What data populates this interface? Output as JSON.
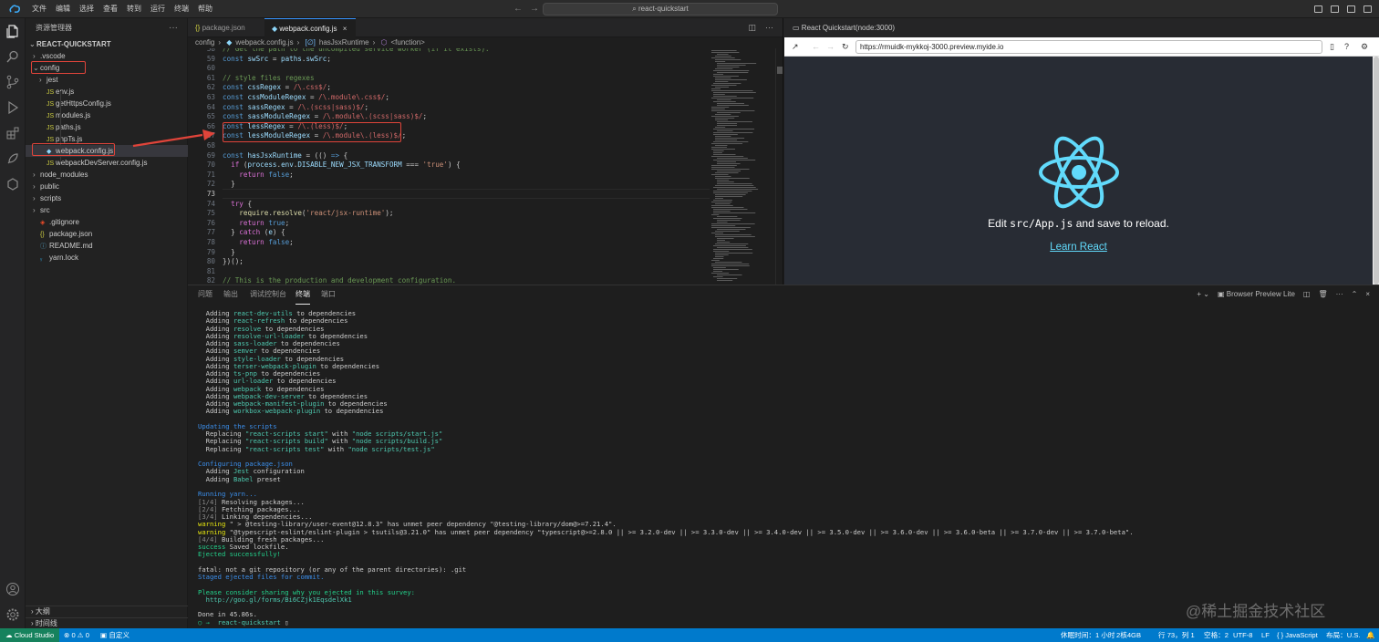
{
  "titlebar": {
    "menu": [
      "文件",
      "编辑",
      "选择",
      "查看",
      "转到",
      "运行",
      "终端",
      "帮助"
    ],
    "command_center": "react-quickstart"
  },
  "sidebar": {
    "title": "资源管理器",
    "root": "REACT-QUICKSTART",
    "items": [
      {
        "label": ".vscode",
        "kind": "folder",
        "open": false,
        "depth": 1
      },
      {
        "label": "config",
        "kind": "folder",
        "open": true,
        "depth": 1
      },
      {
        "label": "jest",
        "kind": "folder",
        "open": false,
        "depth": 2
      },
      {
        "label": "env.js",
        "kind": "js",
        "depth": 2
      },
      {
        "label": "getHttpsConfig.js",
        "kind": "js",
        "depth": 2
      },
      {
        "label": "modules.js",
        "kind": "js",
        "depth": 2
      },
      {
        "label": "paths.js",
        "kind": "js",
        "depth": 2
      },
      {
        "label": "pnpTs.js",
        "kind": "js",
        "depth": 2
      },
      {
        "label": "webpack.config.js",
        "kind": "webpack",
        "depth": 2,
        "selected": true
      },
      {
        "label": "webpackDevServer.config.js",
        "kind": "js",
        "depth": 2
      },
      {
        "label": "node_modules",
        "kind": "folder",
        "open": false,
        "depth": 1
      },
      {
        "label": "public",
        "kind": "folder",
        "open": false,
        "depth": 1
      },
      {
        "label": "scripts",
        "kind": "folder",
        "open": false,
        "depth": 1
      },
      {
        "label": "src",
        "kind": "folder",
        "open": false,
        "depth": 1
      },
      {
        "label": ".gitignore",
        "kind": "git",
        "depth": 1
      },
      {
        "label": "package.json",
        "kind": "json",
        "depth": 1
      },
      {
        "label": "README.md",
        "kind": "info",
        "depth": 1
      },
      {
        "label": "yarn.lock",
        "kind": "yarn",
        "depth": 1
      }
    ],
    "outline": "大纲",
    "timeline": "时间线"
  },
  "editor": {
    "tabs": [
      {
        "label": "package.json",
        "icon": "{}",
        "active": false
      },
      {
        "label": "webpack.config.js",
        "icon": "webpack-icon",
        "active": true
      }
    ],
    "breadcrumb": [
      "config",
      "webpack.config.js",
      "hasJsxRuntime",
      "<function>"
    ],
    "code_lines": [
      {
        "n": "58",
        "html": "<span class=\"cm\">// Get the path to the uncompiled service worker (if it exists).</span>"
      },
      {
        "n": "59",
        "html": "<span class=\"kw\">const</span> <span class=\"vr\">swSrc</span> = <span class=\"vr\">paths</span>.<span class=\"vr\">swSrc</span>;"
      },
      {
        "n": "60",
        "html": ""
      },
      {
        "n": "61",
        "html": "<span class=\"cm\">// style files regexes</span>"
      },
      {
        "n": "62",
        "html": "<span class=\"kw\">const</span> <span class=\"vr\">cssRegex</span> = <span class=\"rx\">/\\.css$/</span>;"
      },
      {
        "n": "63",
        "html": "<span class=\"kw\">const</span> <span class=\"vr\">cssModuleRegex</span> = <span class=\"rx\">/\\.module\\.css$/</span>;"
      },
      {
        "n": "64",
        "html": "<span class=\"kw\">const</span> <span class=\"vr\">sassRegex</span> = <span class=\"rx\">/\\.(scss|sass)$/</span>;"
      },
      {
        "n": "65",
        "html": "<span class=\"kw\">const</span> <span class=\"vr\">sassModuleRegex</span> = <span class=\"rx\">/\\.module\\.(scss|sass)$/</span>;"
      },
      {
        "n": "66",
        "html": "<span class=\"kw\">const</span> <span class=\"vr\">lessRegex</span> = <span class=\"rx\">/\\.(less)$/</span>;"
      },
      {
        "n": "67",
        "html": "<span class=\"kw\">const</span> <span class=\"vr\">lessModuleRegex</span> = <span class=\"rx\">/\\.module\\.(less)$/</span>;"
      },
      {
        "n": "68",
        "html": ""
      },
      {
        "n": "69",
        "html": "<span class=\"kw\">const</span> <span class=\"vr\">hasJsxRuntime</span> = (() <span class=\"kw\">=&gt;</span> {"
      },
      {
        "n": "70",
        "html": "  <span class=\"br\">if</span> (<span class=\"vr\">process</span>.<span class=\"vr\">env</span>.<span class=\"vr\">DISABLE_NEW_JSX_TRANSFORM</span> === <span class=\"st\">'true'</span>) {"
      },
      {
        "n": "71",
        "html": "    <span class=\"br\">return</span> <span class=\"kw\">false</span>;"
      },
      {
        "n": "72",
        "html": "  }"
      },
      {
        "n": "73",
        "html": ""
      },
      {
        "n": "74",
        "html": "  <span class=\"br\">try</span> {"
      },
      {
        "n": "75",
        "html": "    <span class=\"fn\">require</span>.<span class=\"fn\">resolve</span>(<span class=\"st\">'react/jsx-runtime'</span>);"
      },
      {
        "n": "76",
        "html": "    <span class=\"br\">return</span> <span class=\"kw\">true</span>;"
      },
      {
        "n": "77",
        "html": "  } <span class=\"br\">catch</span> (<span class=\"vr\">e</span>) {"
      },
      {
        "n": "78",
        "html": "    <span class=\"br\">return</span> <span class=\"kw\">false</span>;"
      },
      {
        "n": "79",
        "html": "  }"
      },
      {
        "n": "80",
        "html": "})();"
      },
      {
        "n": "81",
        "html": ""
      },
      {
        "n": "82",
        "html": "<span class=\"cm\">// This is the production and development configuration.</span>"
      }
    ]
  },
  "preview": {
    "tab_title": "React Quickstart(node:3000)",
    "url": "https://rmuidk-mykkoj-3000.preview.myide.io",
    "message_prefix": "Edit ",
    "message_code": "src/App.js",
    "message_suffix": " and save to reload.",
    "link": "Learn React",
    "colors": {
      "background": "#282c34",
      "logo": "#61dafb"
    }
  },
  "panel": {
    "tabs": [
      "问题",
      "输出",
      "调试控制台",
      "终端",
      "端口"
    ],
    "active_tab": "终端",
    "terminal_name": "Browser Preview Lite",
    "terminal_lines": [
      "  Adding <span class=\"tc\">react-dev-utils</span> to dependencies",
      "  Adding <span class=\"tc\">react-refresh</span> to dependencies",
      "  Adding <span class=\"tc\">resolve</span> to dependencies",
      "  Adding <span class=\"tc\">resolve-url-loader</span> to dependencies",
      "  Adding <span class=\"tc\">sass-loader</span> to dependencies",
      "  Adding <span class=\"tc\">semver</span> to dependencies",
      "  Adding <span class=\"tc\">style-loader</span> to dependencies",
      "  Adding <span class=\"tc\">terser-webpack-plugin</span> to dependencies",
      "  Adding <span class=\"tc\">ts-pnp</span> to dependencies",
      "  Adding <span class=\"tc\">url-loader</span> to dependencies",
      "  Adding <span class=\"tc\">webpack</span> to dependencies",
      "  Adding <span class=\"tc\">webpack-dev-server</span> to dependencies",
      "  Adding <span class=\"tc\">webpack-manifest-plugin</span> to dependencies",
      "  Adding <span class=\"tc\">workbox-webpack-plugin</span> to dependencies",
      "",
      "<span class=\"tb\">Updating the scripts</span>",
      "  Replacing <span class=\"tc\">\"react-scripts start\"</span> with <span class=\"tc\">\"node scripts/start.js\"</span>",
      "  Replacing <span class=\"tc\">\"react-scripts build\"</span> with <span class=\"tc\">\"node scripts/build.js\"</span>",
      "  Replacing <span class=\"tc\">\"react-scripts test\"</span> with <span class=\"tc\">\"node scripts/test.js\"</span>",
      "",
      "<span class=\"tb\">Configuring package.json</span>",
      "  Adding <span class=\"tc\">Jest</span> configuration",
      "  Adding <span class=\"tc\">Babel</span> preset",
      "",
      "<span class=\"tb\">Running yarn...</span>",
      "<span class=\"tgr\">[1/4]</span> Resolving packages...",
      "<span class=\"tgr\">[2/4]</span> Fetching packages...",
      "<span class=\"tgr\">[3/4]</span> Linking dependencies...",
      "<span class=\"ty\">warning</span> \" &gt; @testing-library/user-event@12.8.3\" has unmet peer dependency \"@testing-library/dom@&gt;=7.21.4\".",
      "<span class=\"ty\">warning</span> \"@typescript-eslint/eslint-plugin &gt; tsutils@3.21.0\" has unmet peer dependency \"typescript@&gt;=2.8.0 || &gt;= 3.2.0-dev || &gt;= 3.3.0-dev || &gt;= 3.4.0-dev || &gt;= 3.5.0-dev || &gt;= 3.6.0-dev || &gt;= 3.6.0-beta || &gt;= 3.7.0-dev || &gt;= 3.7.0-beta\".",
      "<span class=\"tgr\">[4/4]</span> Building fresh packages...",
      "<span class=\"tg\">success</span> Saved lockfile.",
      "<span class=\"tg\">Ejected successfully!</span>",
      "",
      "fatal: not a git repository (or any of the parent directories): .git",
      "<span class=\"tb\">Staged ejected files for commit.</span>",
      "",
      "<span class=\"tg\">Please consider sharing why you ejected in this survey:</span>",
      "  <span class=\"tc\">http://goo.gl/forms/Bi6CZjk1EqsdelXk1</span>",
      "",
      "Done in 45.86s.",
      "<span class=\"tg\">○ →</span>  <span class=\"tc\">react-quickstart</span> ▯"
    ]
  },
  "statusbar": {
    "remote": "Cloud Studio",
    "problems": "⊗ 0 ⚠ 0",
    "custom": "自定义",
    "right": {
      "rest": "休眠时间：1 小时",
      "cpu_mem": "2核4GB",
      "position": "行 73，列 1",
      "spaces": "空格：2",
      "encoding": "UTF-8",
      "eol": "LF",
      "language": "JavaScript",
      "layout": "布局：U.S."
    }
  },
  "watermark": "@稀土掘金技术社区",
  "accent": {
    "annotation_red": "#e0443a",
    "statusbar_blue": "#007acc"
  }
}
